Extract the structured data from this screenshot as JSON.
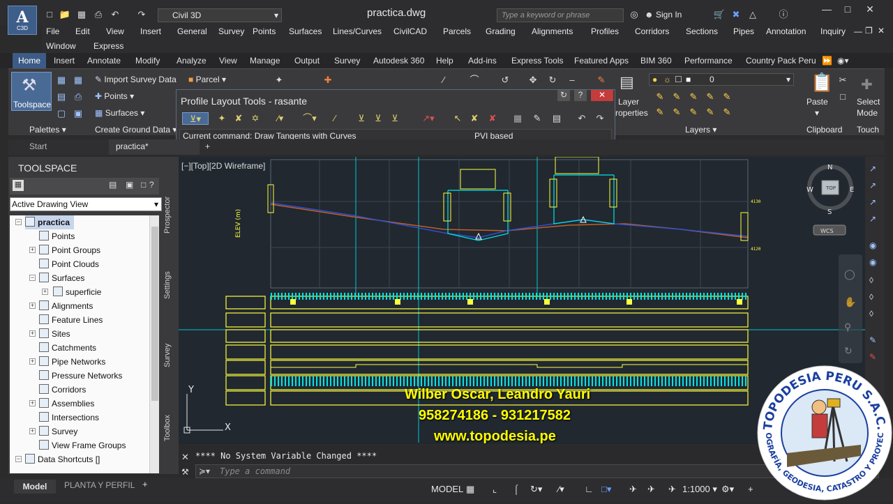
{
  "app": {
    "logo_letter": "A",
    "logo_sub": "C3D",
    "workspace": "Civil 3D",
    "doc_title": "practica.dwg",
    "search_placeholder": "Type a keyword or phrase",
    "sign_in": "Sign In"
  },
  "menubar": {
    "row1": [
      "File",
      "Edit",
      "View",
      "Insert",
      "General",
      "Survey",
      "Points",
      "Surfaces",
      "Lines/Curves",
      "CivilCAD",
      "Parcels",
      "Grading",
      "Alignments",
      "Profiles",
      "Corridors",
      "Sections",
      "Pipes",
      "Annotation",
      "Inquiry"
    ],
    "row2": [
      "Window",
      "Express"
    ]
  },
  "ribbon_tabs": [
    "Home",
    "Insert",
    "Annotate",
    "Modify",
    "Analyze",
    "View",
    "Manage",
    "Output",
    "Survey",
    "Autodesk 360",
    "Help",
    "Add-ins",
    "Express Tools",
    "Featured Apps",
    "BIM 360",
    "Performance",
    "Country Pack Peru"
  ],
  "ribbon": {
    "toolspace": "Toolspace",
    "import_survey": "Import Survey Data",
    "points": "Points",
    "surfaces": "Surfaces",
    "parcel": "Parcel",
    "palettes": "Palettes",
    "create_ground": "Create Ground Data",
    "layer_props_1": "Layer",
    "layer_props_2": "roperties",
    "layers": "Layers",
    "layer_value": "0",
    "paste": "Paste",
    "clipboard": "Clipboard",
    "select_mode_1": "Select",
    "select_mode_2": "Mode",
    "touch": "Touch"
  },
  "profile_tools": {
    "title": "Profile Layout Tools - rasante",
    "command": "Current command: Draw Tangents with Curves",
    "mode": "PVI based"
  },
  "doc_tabs": {
    "start": "Start",
    "current": "practica*"
  },
  "toolspace": {
    "header": "TOOLSPACE",
    "view": "Active Drawing View",
    "root": "practica",
    "items": [
      "Points",
      "Point Groups",
      "Point Clouds",
      "Surfaces",
      "superficie",
      "Alignments",
      "Feature Lines",
      "Sites",
      "Catchments",
      "Pipe Networks",
      "Pressure Networks",
      "Corridors",
      "Assemblies",
      "Intersections",
      "Survey",
      "View Frame Groups",
      "Data Shortcuts []"
    ],
    "side_tabs": [
      "Prospector",
      "Settings",
      "Survey",
      "Toolbox"
    ]
  },
  "viewport": {
    "label": "[−][Top][2D Wireframe]",
    "compass_n": "N",
    "compass_s": "S",
    "compass_e": "E",
    "compass_w": "W",
    "compass_top": "TOP",
    "wcs": "WCS",
    "axis_y": "Y",
    "axis_x": "X",
    "overlay_name": "Wilber Oscar, Leandro Yauri",
    "overlay_phone": "958274186 - 931217582",
    "overlay_web": "www.topodesia.pe",
    "elev_top": "4130",
    "elev_bottom": "4120"
  },
  "command": {
    "history": "**** No System Variable Changed ****",
    "placeholder": "Type a command"
  },
  "statusbar": {
    "model_tab": "Model",
    "layout_tab": "PLANTA Y PERFIL",
    "model": "MODEL",
    "scale": "1:1000"
  },
  "watermark": {
    "top_text": "TOPODESIA PERU S.A.C.",
    "bottom_text": "TOPOGRAFÍA, GEODESIA, CATASTRO Y PROYECTOS"
  },
  "colors": {
    "accent": "#3c5b86",
    "cad_yellow": "#ffff3c",
    "cad_cyan": "#00e5e5",
    "overlay_text": "#ffff00"
  }
}
